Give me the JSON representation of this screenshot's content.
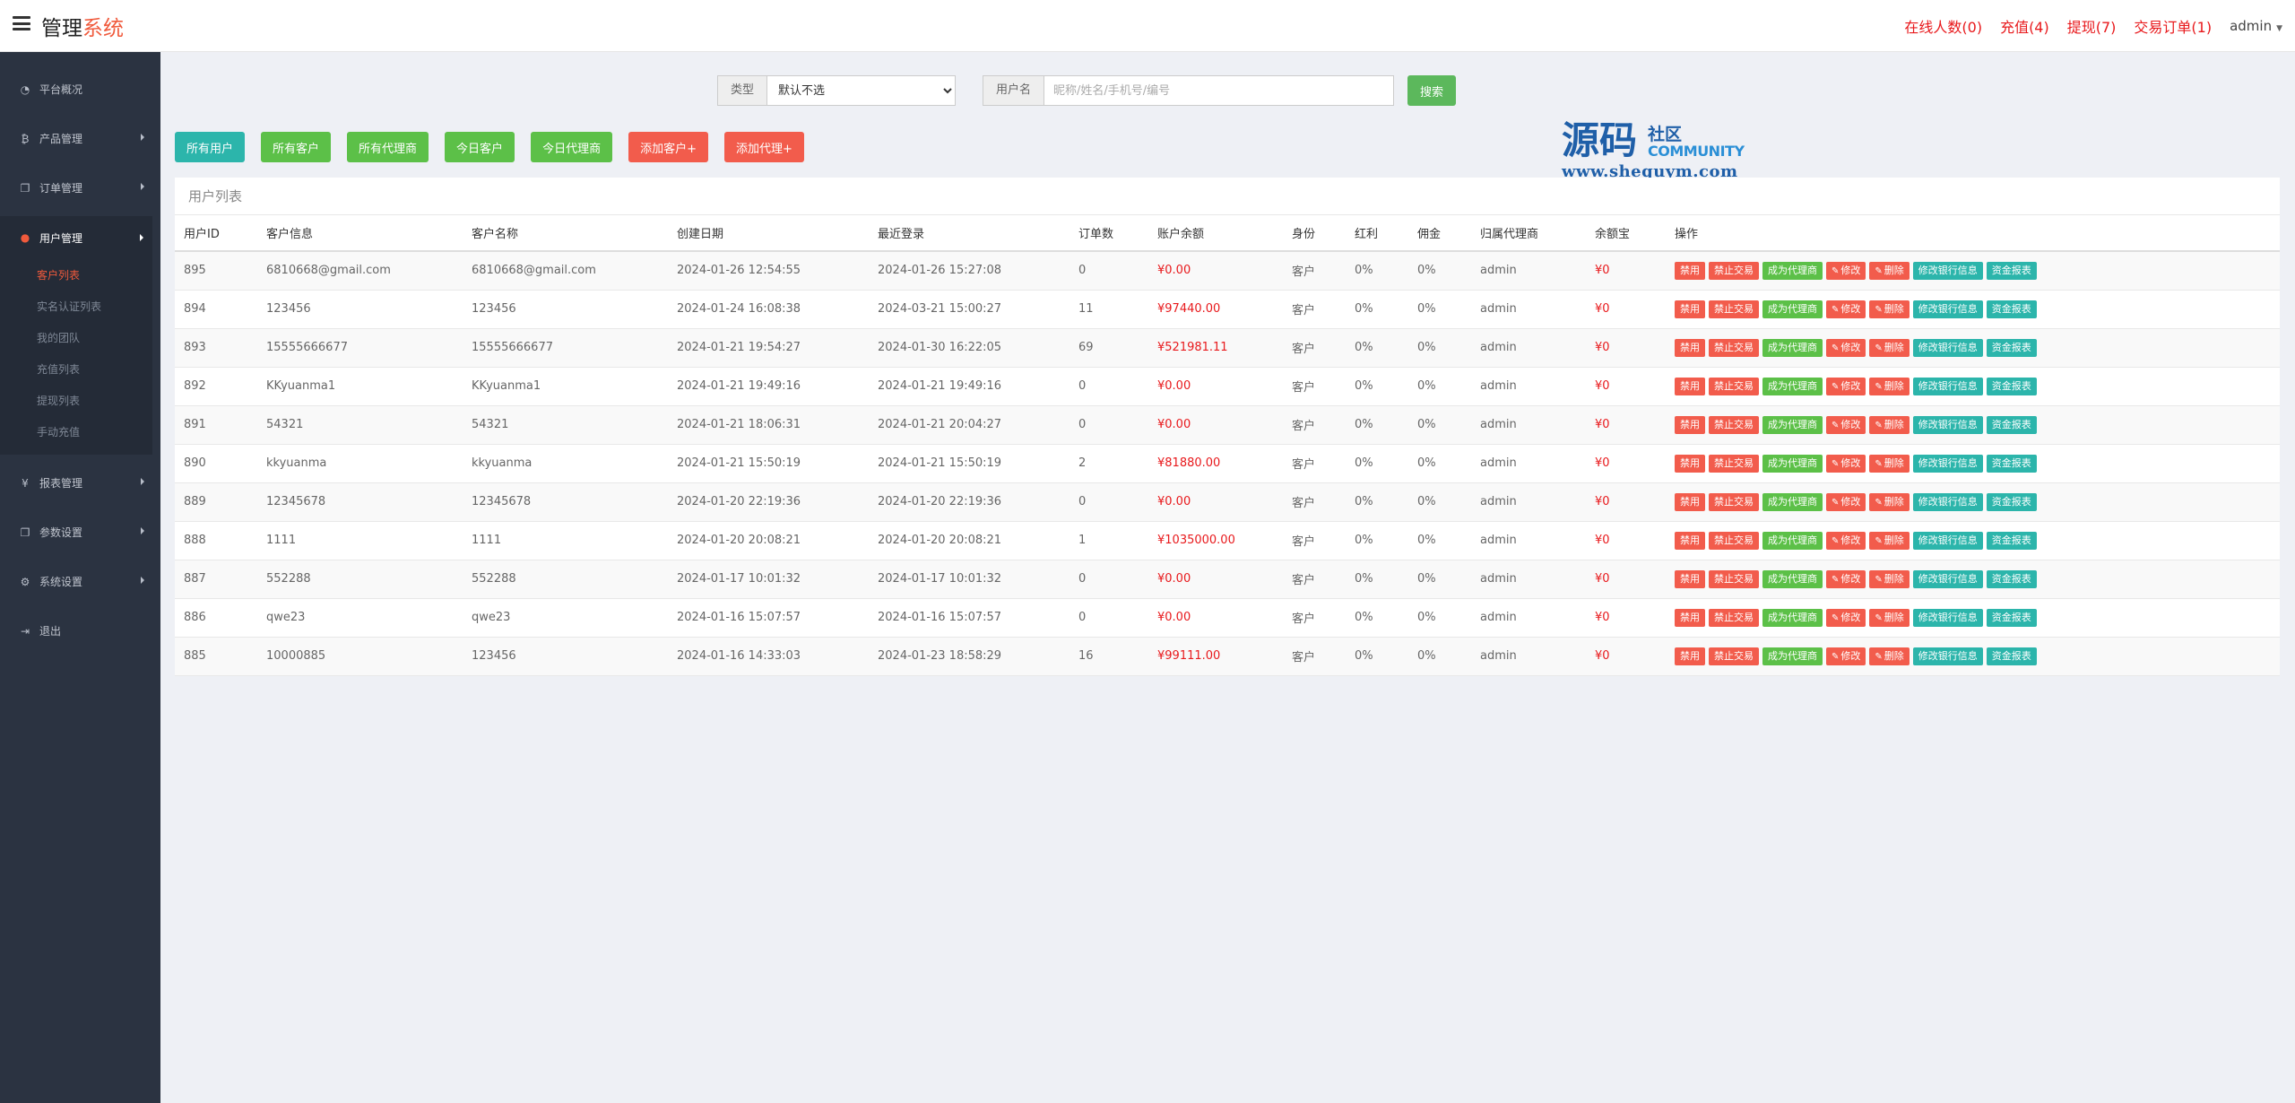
{
  "header": {
    "brand_main": "管理",
    "brand_accent": "系统",
    "links": [
      "在线人数(0)",
      "充值(4)",
      "提现(7)",
      "交易订单(1)"
    ],
    "user": "admin"
  },
  "sidebar": {
    "items": [
      {
        "label": "平台概况",
        "icon": "dashboard-icon",
        "glyph": "◔"
      },
      {
        "label": "产品管理",
        "icon": "bitcoin-icon",
        "glyph": "₿"
      },
      {
        "label": "订单管理",
        "icon": "copy-icon",
        "glyph": "❐"
      },
      {
        "label": "用户管理",
        "icon": "user-icon",
        "glyph": "●"
      },
      {
        "label": "报表管理",
        "icon": "yen-icon",
        "glyph": "¥"
      },
      {
        "label": "参数设置",
        "icon": "copy-icon",
        "glyph": "❐"
      },
      {
        "label": "系统设置",
        "icon": "gears-icon",
        "glyph": "⚙"
      },
      {
        "label": "退出",
        "icon": "sign-out-icon",
        "glyph": "⇥"
      }
    ],
    "submenu": [
      "客户列表",
      "实名认证列表",
      "我的团队",
      "充值列表",
      "提现列表",
      "手动充值"
    ]
  },
  "search": {
    "type_label": "类型",
    "type_value": "默认不选",
    "user_label": "用户名",
    "user_placeholder": "昵称/姓名/手机号/编号",
    "button": "搜索"
  },
  "filters": [
    "所有用户",
    "所有客户",
    "所有代理商",
    "今日客户",
    "今日代理商",
    "添加客户+",
    "添加代理+"
  ],
  "watermark": {
    "big": "源码",
    "small": "社区",
    "community": "COMMUNITY",
    "url": "www.shequym.com"
  },
  "panel_title": "用户列表",
  "table": {
    "headers": [
      "用户ID",
      "客户信息",
      "客户名称",
      "创建日期",
      "最近登录",
      "订单数",
      "账户余额",
      "身份",
      "红利",
      "佣金",
      "归属代理商",
      "余额宝",
      "操作"
    ],
    "rows": [
      [
        "895",
        "6810668@gmail.com",
        "6810668@gmail.com",
        "2024-01-26 12:54:55",
        "2024-01-26 15:27:08",
        "0",
        "¥0.00",
        "客户",
        "0%",
        "0%",
        "admin",
        "¥0"
      ],
      [
        "894",
        "123456",
        "123456",
        "2024-01-24 16:08:38",
        "2024-03-21 15:00:27",
        "11",
        "¥97440.00",
        "客户",
        "0%",
        "0%",
        "admin",
        "¥0"
      ],
      [
        "893",
        "15555666677",
        "15555666677",
        "2024-01-21 19:54:27",
        "2024-01-30 16:22:05",
        "69",
        "¥521981.11",
        "客户",
        "0%",
        "0%",
        "admin",
        "¥0"
      ],
      [
        "892",
        "KKyuanma1",
        "KKyuanma1",
        "2024-01-21 19:49:16",
        "2024-01-21 19:49:16",
        "0",
        "¥0.00",
        "客户",
        "0%",
        "0%",
        "admin",
        "¥0"
      ],
      [
        "891",
        "54321",
        "54321",
        "2024-01-21 18:06:31",
        "2024-01-21 20:04:27",
        "0",
        "¥0.00",
        "客户",
        "0%",
        "0%",
        "admin",
        "¥0"
      ],
      [
        "890",
        "kkyuanma",
        "kkyuanma",
        "2024-01-21 15:50:19",
        "2024-01-21 15:50:19",
        "2",
        "¥81880.00",
        "客户",
        "0%",
        "0%",
        "admin",
        "¥0"
      ],
      [
        "889",
        "12345678",
        "12345678",
        "2024-01-20 22:19:36",
        "2024-01-20 22:19:36",
        "0",
        "¥0.00",
        "客户",
        "0%",
        "0%",
        "admin",
        "¥0"
      ],
      [
        "888",
        "1111",
        "1111",
        "2024-01-20 20:08:21",
        "2024-01-20 20:08:21",
        "1",
        "¥1035000.00",
        "客户",
        "0%",
        "0%",
        "admin",
        "¥0"
      ],
      [
        "887",
        "552288",
        "552288",
        "2024-01-17 10:01:32",
        "2024-01-17 10:01:32",
        "0",
        "¥0.00",
        "客户",
        "0%",
        "0%",
        "admin",
        "¥0"
      ],
      [
        "886",
        "qwe23",
        "qwe23",
        "2024-01-16 15:07:57",
        "2024-01-16 15:07:57",
        "0",
        "¥0.00",
        "客户",
        "0%",
        "0%",
        "admin",
        "¥0"
      ],
      [
        "885",
        "10000885",
        "123456",
        "2024-01-16 14:33:03",
        "2024-01-23 18:58:29",
        "16",
        "¥99111.00",
        "客户",
        "0%",
        "0%",
        "admin",
        "¥0"
      ]
    ],
    "actions": [
      "禁用",
      "禁止交易",
      "成为代理商",
      "修改",
      "删除",
      "修改银行信息",
      "资金报表"
    ]
  },
  "colors": {
    "accent": "#f05a3c",
    "danger": "#f25c4c",
    "success": "#5cc048",
    "info": "#2cb5ab",
    "sidebar": "#2b3341"
  }
}
